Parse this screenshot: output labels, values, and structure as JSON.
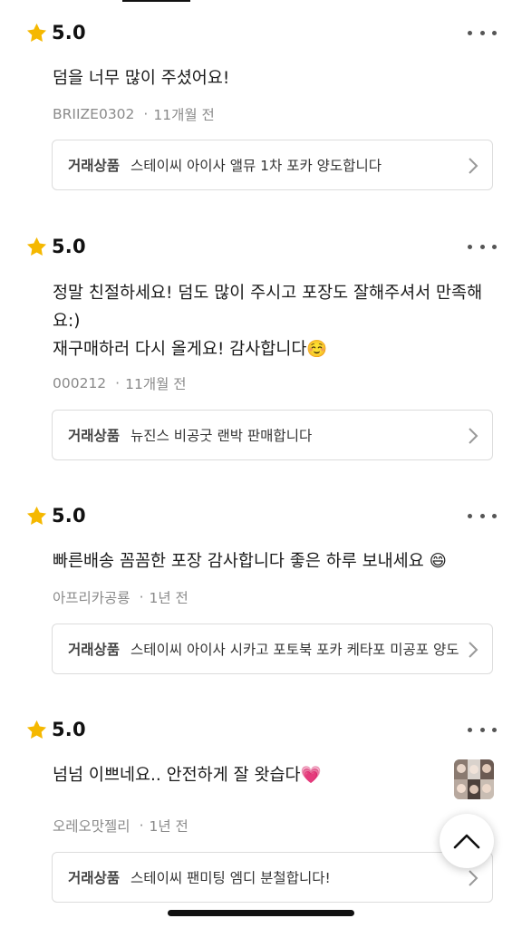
{
  "reviews": [
    {
      "rating": "5.0",
      "text_lines": [
        "덤을 너무 많이 주셨어요!"
      ],
      "author": "BRIIZE0302",
      "time": "11개월 전",
      "product_label": "거래상품",
      "product_name": "스테이씨 아이사 앨뮤 1차 포카 양도합니다"
    },
    {
      "rating": "5.0",
      "text_lines": [
        "정말 친절하세요! 덤도 많이 주시고 포장도 잘해주셔서 만족해",
        "요:)",
        "재구매하러 다시 올게요! 감사합니다☺️"
      ],
      "author": "000212",
      "time": "11개월 전",
      "product_label": "거래상품",
      "product_name": "뉴진스 비공굿 랜박 판매합니다"
    },
    {
      "rating": "5.0",
      "text_lines": [
        "빠른배송 꼼꼼한 포장 감사합니다 좋은 하루 보내세요 😄"
      ],
      "author": "아프리카공룡",
      "time": "1년 전",
      "product_label": "거래상품",
      "product_name": "스테이씨 아이사 시카고 포토북 포카 케타포 미공포 양도"
    },
    {
      "rating": "5.0",
      "text_lines": [
        "넘넘 이쁘네요.. 안전하게 잘 왓습다💗"
      ],
      "author": "오레오맛젤리",
      "time": "1년 전",
      "product_label": "거래상품",
      "product_name": "스테이씨 팬미팅 엠디 분철합니다!"
    }
  ],
  "icons": {
    "star": "star-icon",
    "more": "more-dots-icon",
    "chevron": "chevron-right-icon",
    "scroll_top": "chevron-up-icon"
  },
  "colors": {
    "star": "#F5B800",
    "meta_text": "#8a8a8a",
    "border": "#dcdcdc"
  }
}
